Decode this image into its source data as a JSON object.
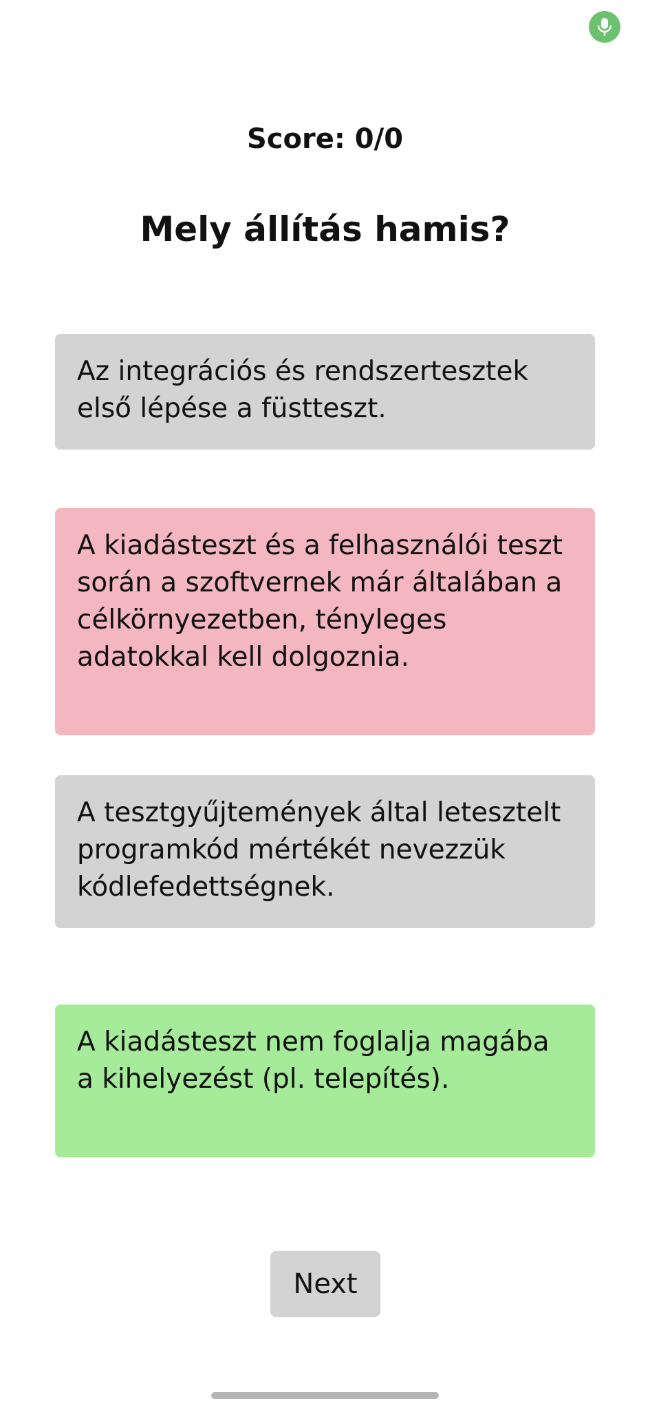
{
  "status": {
    "mic_icon": "microphone-icon",
    "mic_color": "#6cc26f"
  },
  "quiz": {
    "score_label": "Score: 0/0",
    "question": "Mely állítás hamis?",
    "answers": [
      {
        "text": "Az integrációs és rendszertesztek első lépése a füstteszt.",
        "state": "neutral",
        "color": "#d3d3d3"
      },
      {
        "text": "A kiadásteszt és a felhasználói teszt során a szoftvernek már általában a célkörnyezetben, tényleges adatokkal kell dolgoznia.",
        "state": "wrong",
        "color": "#f4b7c0"
      },
      {
        "text": "A tesztgyűjtemények által letesztelt programkód mértékét nevezzük kódlefedettségnek.",
        "state": "neutral",
        "color": "#d3d3d3"
      },
      {
        "text": "A kiadásteszt nem foglalja magába a kihelyezést (pl. telepítés).",
        "state": "correct",
        "color": "#a5eb99"
      }
    ],
    "next_label": "Next"
  }
}
